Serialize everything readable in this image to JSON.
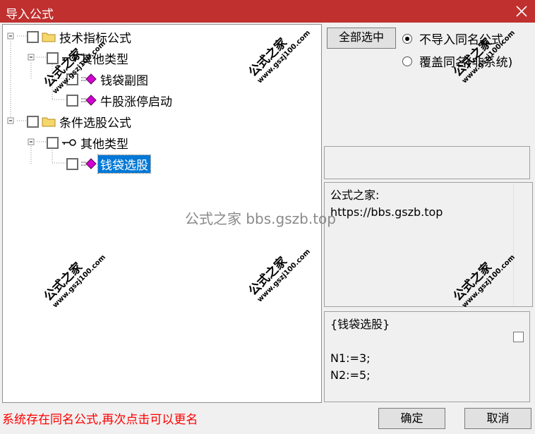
{
  "window": {
    "title": "导入公式"
  },
  "tree": {
    "nodes": [
      {
        "label": "技术指标公式"
      },
      {
        "label": "其他类型"
      },
      {
        "label": "钱袋副图"
      },
      {
        "label": "牛股涨停启动"
      },
      {
        "label": "条件选股公式"
      },
      {
        "label": "其他类型"
      },
      {
        "label": "钱袋选股"
      }
    ]
  },
  "options": {
    "select_all_label": "全部选中",
    "radio_no_import_same": "不导入同名公式",
    "radio_overwrite_same": "覆盖同名(非系统)",
    "selected_radio": "no_import_same"
  },
  "info": {
    "line1": "公式之家:",
    "line2": "https://bbs.gszb.top"
  },
  "formula": {
    "header": "{钱袋选股}",
    "line1": "N1:=3;",
    "line2": "N2:=5;"
  },
  "status_text": "系统存在同名公式,再次点击可以更名",
  "buttons": {
    "ok": "确定",
    "cancel": "取消"
  },
  "watermark": {
    "brand": "公式之家",
    "site": "www.gszj100.com",
    "center": "公式之家 bbs.gszb.top"
  },
  "colors": {
    "titlebar": "#c0302f",
    "selection": "#0078d7",
    "status": "#ff0000"
  }
}
